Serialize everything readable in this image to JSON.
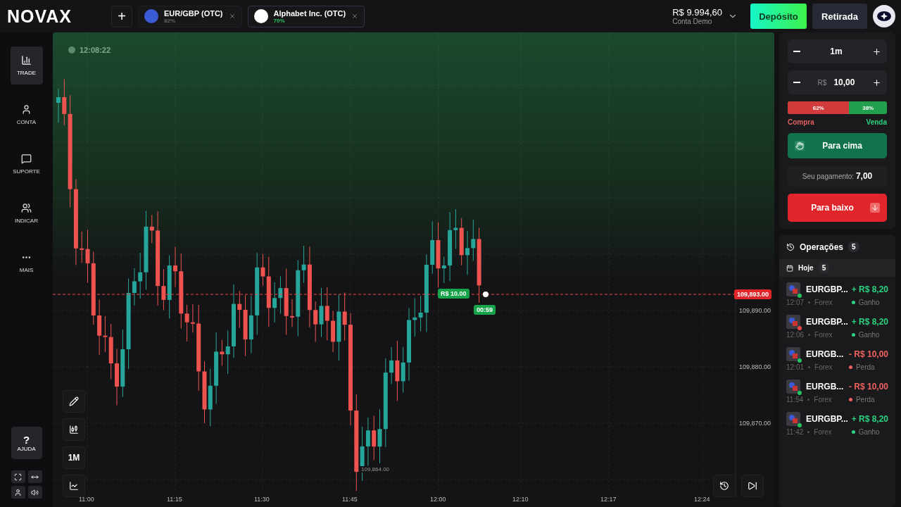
{
  "header": {
    "logo": "NOVAX",
    "add_tab": "+",
    "asset_tabs": [
      {
        "name": "EUR/GBP (OTC)",
        "payout": "82%",
        "selected": false,
        "kind": "flag"
      },
      {
        "name": "Alphabet Inc. (OTC)",
        "payout": "70%",
        "selected": true,
        "kind": "brand"
      }
    ],
    "balance": {
      "amount": "R$ 9.994,60",
      "account": "Conta Demo"
    },
    "deposit": "Depósito",
    "withdraw": "Retirada"
  },
  "sidebar": {
    "items": [
      {
        "label": "TRADE",
        "selected": true
      },
      {
        "label": "CONTA",
        "selected": false
      },
      {
        "label": "SUPORTE",
        "selected": false
      },
      {
        "label": "INDICAR",
        "selected": false
      },
      {
        "label": "MAIS",
        "selected": false
      }
    ],
    "help": {
      "glyph": "?",
      "label": "AJUDA"
    }
  },
  "chart": {
    "clock": "12:08:22",
    "price_axis": [
      "109,890.00",
      "109,880.00",
      "109,870.00"
    ],
    "current_price": "109,893.00",
    "time_axis": [
      "11:00",
      "11:15",
      "11:30",
      "11:45",
      "12:00",
      "12:10",
      "12:17",
      "12:24"
    ],
    "trade_amount": "R$ 10.00",
    "trade_timer": "00:59",
    "low_label": "109,864.00",
    "interval": "1M"
  },
  "panel": {
    "duration": "1m",
    "currency": "R$",
    "amount": "10,00",
    "sentiment": {
      "level": 0.62,
      "buy_share": "62%",
      "sell_share": "38%",
      "buy_label": "Compra",
      "sell_label": "Venda"
    },
    "up_button": "Para cima",
    "payout_label": "Seu pagamento:",
    "payout_value": "7,00",
    "down_button": "Para baixo"
  },
  "operations": {
    "title": "Operações",
    "count": "5",
    "group": {
      "label": "Hoje",
      "count": "5"
    },
    "items": [
      {
        "asset": "EURGBP...",
        "amount": "+ R$ 8,20",
        "time": "12:07",
        "category": "Forex",
        "result": "Ganho",
        "kind": "gain",
        "color": "#22c55e"
      },
      {
        "asset": "EURGBP...",
        "amount": "+ R$ 8,20",
        "time": "12:06",
        "category": "Forex",
        "result": "Ganho",
        "kind": "gain",
        "color": "#ef4444"
      },
      {
        "asset": "EURGB...",
        "amount": "- R$ 10,00",
        "time": "12:01",
        "category": "Forex",
        "result": "Perda",
        "kind": "loss",
        "color": "#22c55e"
      },
      {
        "asset": "EURGB...",
        "amount": "- R$ 10,00",
        "time": "11:54",
        "category": "Forex",
        "result": "Perda",
        "kind": "loss",
        "color": "#22c55e"
      },
      {
        "asset": "EURGBP...",
        "amount": "+ R$ 8,20",
        "time": "11:42",
        "category": "Forex",
        "result": "Ganho",
        "kind": "gain",
        "color": "#22c55e"
      }
    ]
  }
}
